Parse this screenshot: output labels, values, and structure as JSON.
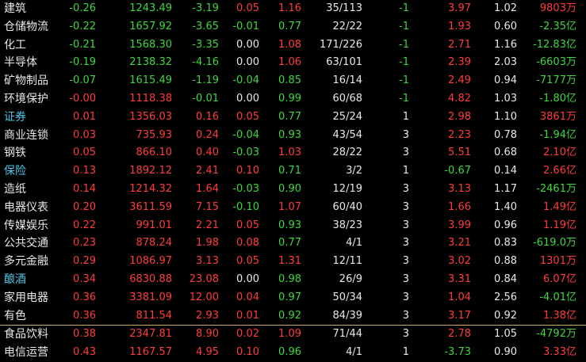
{
  "rows": [
    {
      "name": "建筑",
      "hl": false,
      "chg": "-0.26",
      "price": "1243.49",
      "amt": "-3.19",
      "spd": "0.05",
      "ratio": "1.16",
      "ud": "35/113",
      "cnt": "-1",
      "lead": "3.97",
      "turn": "1.02",
      "flow": "9803",
      "unit": "万"
    },
    {
      "name": "仓储物流",
      "hl": false,
      "chg": "-0.22",
      "price": "1657.92",
      "amt": "-3.65",
      "spd": "-0.01",
      "ratio": "0.77",
      "ud": "22/22",
      "cnt": "-1",
      "lead": "1.93",
      "turn": "0.60",
      "flow": "-2.35",
      "unit": "亿"
    },
    {
      "name": "化工",
      "hl": false,
      "chg": "-0.21",
      "price": "1568.30",
      "amt": "-3.35",
      "spd": "0.00",
      "ratio": "1.08",
      "ud": "171/226",
      "cnt": "-1",
      "lead": "2.71",
      "turn": "1.16",
      "flow": "-12.83",
      "unit": "亿"
    },
    {
      "name": "半导体",
      "hl": false,
      "chg": "-0.19",
      "price": "2138.32",
      "amt": "-4.16",
      "spd": "0.00",
      "ratio": "1.06",
      "ud": "63/101",
      "cnt": "-1",
      "lead": "2.39",
      "turn": "2.03",
      "flow": "-6603",
      "unit": "万"
    },
    {
      "name": "矿物制品",
      "hl": false,
      "chg": "-0.07",
      "price": "1615.49",
      "amt": "-1.19",
      "spd": "-0.04",
      "ratio": "0.85",
      "ud": "16/14",
      "cnt": "-1",
      "lead": "2.49",
      "turn": "0.94",
      "flow": "-7177",
      "unit": "万"
    },
    {
      "name": "环境保护",
      "hl": false,
      "chg": "-0.00",
      "price": "1118.38",
      "amt": "-0.01",
      "spd": "0.00",
      "ratio": "0.99",
      "ud": "60/68",
      "cnt": "-1",
      "lead": "4.82",
      "turn": "1.03",
      "flow": "-1.80",
      "unit": "亿"
    },
    {
      "name": "证券",
      "hl": true,
      "chg": "0.01",
      "price": "1356.03",
      "amt": "0.16",
      "spd": "0.05",
      "ratio": "0.77",
      "ud": "25/24",
      "cnt": "1",
      "lead": "2.98",
      "turn": "1.10",
      "flow": "3861",
      "unit": "万"
    },
    {
      "name": "商业连锁",
      "hl": false,
      "chg": "0.03",
      "price": "735.93",
      "amt": "0.24",
      "spd": "-0.04",
      "ratio": "0.93",
      "ud": "43/54",
      "cnt": "3",
      "lead": "2.23",
      "turn": "0.78",
      "flow": "-1.94",
      "unit": "亿"
    },
    {
      "name": "钢铁",
      "hl": false,
      "chg": "0.05",
      "price": "866.10",
      "amt": "0.40",
      "spd": "-0.03",
      "ratio": "1.03",
      "ud": "28/22",
      "cnt": "3",
      "lead": "5.51",
      "turn": "0.68",
      "flow": "2.10",
      "unit": "亿"
    },
    {
      "name": "保险",
      "hl": true,
      "chg": "0.13",
      "price": "1892.12",
      "amt": "2.41",
      "spd": "0.10",
      "ratio": "0.71",
      "ud": "3/2",
      "cnt": "1",
      "lead": "-0.67",
      "turn": "0.14",
      "flow": "2.66",
      "unit": "亿"
    },
    {
      "name": "造纸",
      "hl": false,
      "chg": "0.14",
      "price": "1214.32",
      "amt": "1.64",
      "spd": "-0.03",
      "ratio": "0.90",
      "ud": "12/19",
      "cnt": "3",
      "lead": "3.13",
      "turn": "1.17",
      "flow": "-2461",
      "unit": "万"
    },
    {
      "name": "电器仪表",
      "hl": false,
      "chg": "0.20",
      "price": "3611.59",
      "amt": "7.15",
      "spd": "-0.10",
      "ratio": "1.07",
      "ud": "60/40",
      "cnt": "3",
      "lead": "1.66",
      "turn": "1.40",
      "flow": "1.49",
      "unit": "亿"
    },
    {
      "name": "传媒娱乐",
      "hl": false,
      "chg": "0.22",
      "price": "991.01",
      "amt": "2.21",
      "spd": "0.05",
      "ratio": "0.93",
      "ud": "38/23",
      "cnt": "3",
      "lead": "3.99",
      "turn": "0.96",
      "flow": "1.19",
      "unit": "亿"
    },
    {
      "name": "公共交通",
      "hl": false,
      "chg": "0.23",
      "price": "878.24",
      "amt": "1.98",
      "spd": "0.08",
      "ratio": "0.77",
      "ud": "4/1",
      "cnt": "3",
      "lead": "3.21",
      "turn": "0.83",
      "flow": "-619.0",
      "unit": "万"
    },
    {
      "name": "多元金融",
      "hl": false,
      "chg": "0.29",
      "price": "1086.97",
      "amt": "3.13",
      "spd": "0.05",
      "ratio": "1.31",
      "ud": "12/11",
      "cnt": "3",
      "lead": "3.02",
      "turn": "0.88",
      "flow": "1301",
      "unit": "万"
    },
    {
      "name": "酿酒",
      "hl": true,
      "chg": "0.34",
      "price": "6830.88",
      "amt": "23.08",
      "spd": "0.00",
      "ratio": "0.98",
      "ud": "26/9",
      "cnt": "3",
      "lead": "3.31",
      "turn": "0.84",
      "flow": "6.07",
      "unit": "亿"
    },
    {
      "name": "家用电器",
      "hl": false,
      "chg": "0.36",
      "price": "3381.09",
      "amt": "12.00",
      "spd": "0.04",
      "ratio": "0.97",
      "ud": "50/34",
      "cnt": "3",
      "lead": "1.04",
      "turn": "2.56",
      "flow": "-4.01",
      "unit": "亿"
    },
    {
      "name": "有色",
      "hl": false,
      "chg": "0.36",
      "price": "811.54",
      "amt": "2.93",
      "spd": "0.01",
      "ratio": "0.92",
      "ud": "84/39",
      "cnt": "3",
      "lead": "3.17",
      "turn": "0.92",
      "flow": "1.38",
      "unit": "亿"
    },
    {
      "name": "食品饮料",
      "hl": false,
      "chg": "0.38",
      "price": "2347.81",
      "amt": "8.90",
      "spd": "0.02",
      "ratio": "1.09",
      "ud": "71/44",
      "cnt": "3",
      "lead": "2.78",
      "turn": "1.05",
      "flow": "-4792",
      "unit": "万"
    },
    {
      "name": "电信运营",
      "hl": false,
      "chg": "0.43",
      "price": "1167.57",
      "amt": "4.95",
      "spd": "0.10",
      "ratio": "0.96",
      "ud": "4/1",
      "cnt": "1",
      "lead": "-3.73",
      "turn": "0.90",
      "flow": "3.33",
      "unit": "亿"
    }
  ],
  "colors": {
    "up": "#ff3c3c",
    "down": "#3fd63f",
    "neutral": "#e8e8e8",
    "highlight": "#4fc3e6",
    "separator": "#c8b26a"
  }
}
